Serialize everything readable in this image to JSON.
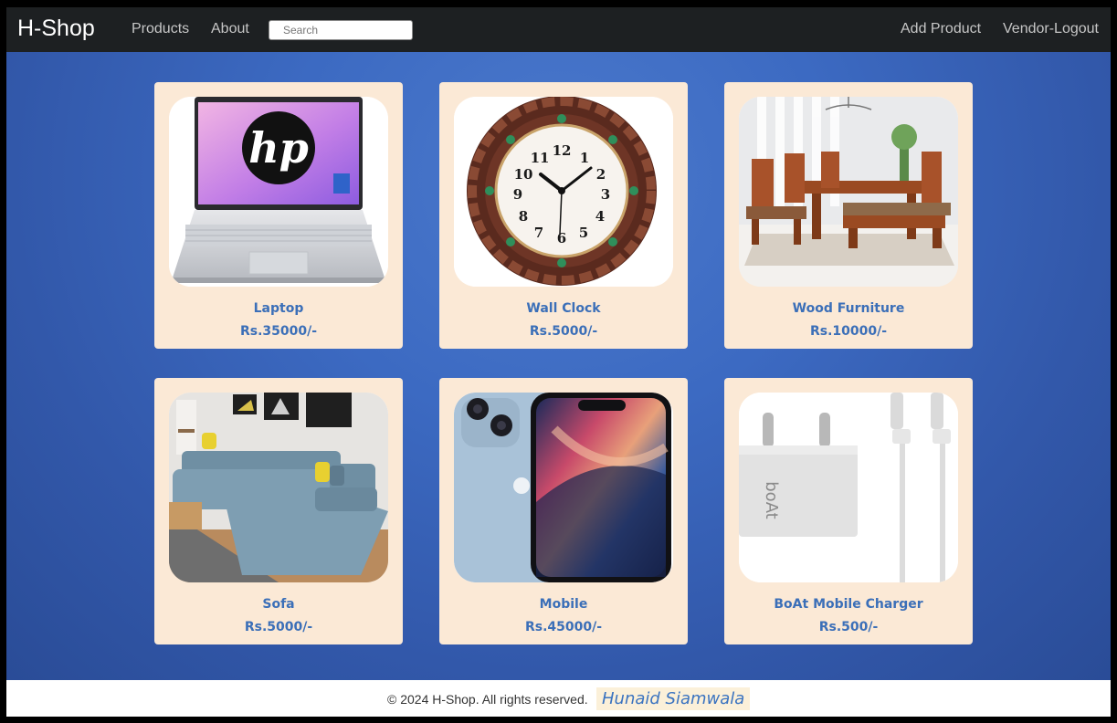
{
  "navbar": {
    "brand": "H-Shop",
    "links": [
      "Products",
      "About"
    ],
    "search_placeholder": "Search",
    "right_links": [
      "Add Product",
      "Vendor-Logout"
    ]
  },
  "products": [
    {
      "name": "Laptop",
      "price": "Rs.35000/-",
      "image_icon": "laptop-image"
    },
    {
      "name": "Wall Clock",
      "price": "Rs.5000/-",
      "image_icon": "wall-clock-image"
    },
    {
      "name": "Wood Furniture",
      "price": "Rs.10000/-",
      "image_icon": "dining-table-image"
    },
    {
      "name": "Sofa",
      "price": "Rs.5000/-",
      "image_icon": "sofa-image"
    },
    {
      "name": "Mobile",
      "price": "Rs.45000/-",
      "image_icon": "smartphone-image"
    },
    {
      "name": "BoAt Mobile Charger",
      "price": "Rs.500/-",
      "image_icon": "charger-image"
    }
  ],
  "image_text": {
    "laptop_logo": "hp",
    "charger_brand": "boAt",
    "clock_numerals": [
      "12",
      "1",
      "2",
      "3",
      "4",
      "5",
      "6",
      "7",
      "8",
      "9",
      "10",
      "11"
    ]
  },
  "footer": {
    "copyright": "© 2024 H-Shop. All rights reserved.",
    "author": "Hunaid Siamwala"
  },
  "colors": {
    "navbar": "#1d2022",
    "background": "#3c6ac2",
    "card": "#fbe9d6",
    "accent_text": "#3b6fb8"
  }
}
